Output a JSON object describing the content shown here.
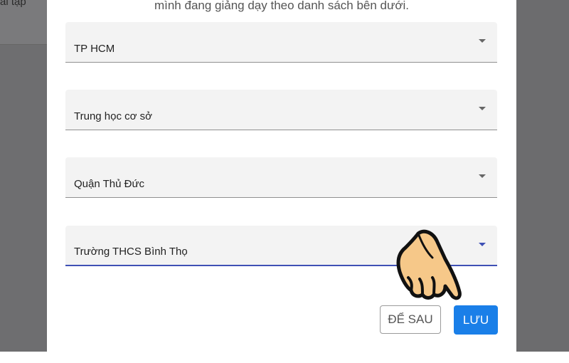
{
  "background": {
    "partial_text": "ài tập"
  },
  "dialog": {
    "subtitle": "mình đang giảng dạy theo danh sách bên dưới.",
    "fields": [
      {
        "value": "TP HCM"
      },
      {
        "value": "Trung học cơ sở"
      },
      {
        "value": "Quận Thủ Đức"
      },
      {
        "value": "Trường THCS Bình Thọ"
      }
    ],
    "buttons": {
      "later": "ĐỂ SAU",
      "save": "LƯU"
    }
  },
  "colors": {
    "accent": "#3f51b5",
    "save_button": "#1a7fe8",
    "hand_fill": "#f6c889"
  },
  "icons": [
    "dropdown-caret-icon",
    "pointing-hand-icon"
  ]
}
